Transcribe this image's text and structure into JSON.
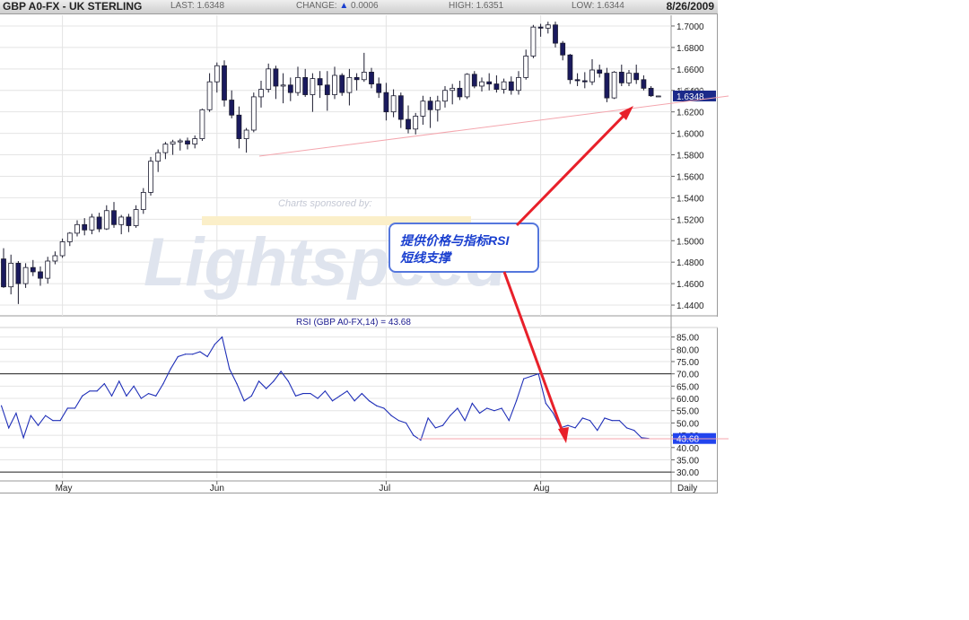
{
  "header": {
    "symbol": "GBP A0-FX - UK STERLING",
    "last_label": "LAST:",
    "last_value": "1.6348",
    "change_label": "CHANGE:",
    "change_arrow": "▲",
    "change_value": "0.0006",
    "high_label": "HIGH:",
    "high_value": "1.6351",
    "low_label": "LOW:",
    "low_value": "1.6344",
    "date": "8/26/2009"
  },
  "watermark": {
    "sponsor_text": "Charts sponsored by:",
    "logo_text": "Lightspeed"
  },
  "annotation": {
    "text_line1": "提供价格与指标RSI",
    "text_line2": "短线支撑",
    "box_border_color": "#5577dd",
    "text_color": "#1a3fcf",
    "arrow_color": "#e8202a",
    "trendline_color": "#f4a6ae"
  },
  "colors": {
    "candle_down": "#1a1a5e",
    "candle_up": "#ffffff",
    "rsi_line": "#1f2fb8",
    "grid": "#e4e4e4",
    "last_badge_bg": "#1b2a8a",
    "rsi_badge_bg": "#2244ee"
  },
  "chart_data": [
    {
      "type": "candlestick",
      "title": "GBP A0-FX - UK STERLING",
      "ylim": [
        1.43,
        1.71
      ],
      "y_ticks": [
        "1.7000",
        "1.6800",
        "1.6600",
        "1.6400",
        "1.6200",
        "1.6000",
        "1.5800",
        "1.5600",
        "1.5400",
        "1.5200",
        "1.5000",
        "1.4800",
        "1.4600",
        "1.4400"
      ],
      "last_price_label": "1.6348",
      "partial_label": "1.6400",
      "candles": [
        {
          "o": 1.483,
          "h": 1.493,
          "l": 1.456,
          "c": 1.457
        },
        {
          "o": 1.457,
          "h": 1.487,
          "l": 1.45,
          "c": 1.479
        },
        {
          "o": 1.479,
          "h": 1.481,
          "l": 1.441,
          "c": 1.46
        },
        {
          "o": 1.46,
          "h": 1.479,
          "l": 1.456,
          "c": 1.475
        },
        {
          "o": 1.475,
          "h": 1.482,
          "l": 1.467,
          "c": 1.471
        },
        {
          "o": 1.471,
          "h": 1.476,
          "l": 1.458,
          "c": 1.465
        },
        {
          "o": 1.465,
          "h": 1.485,
          "l": 1.46,
          "c": 1.481
        },
        {
          "o": 1.481,
          "h": 1.49,
          "l": 1.478,
          "c": 1.486
        },
        {
          "o": 1.486,
          "h": 1.502,
          "l": 1.484,
          "c": 1.499
        },
        {
          "o": 1.499,
          "h": 1.508,
          "l": 1.495,
          "c": 1.507
        },
        {
          "o": 1.507,
          "h": 1.519,
          "l": 1.504,
          "c": 1.515
        },
        {
          "o": 1.515,
          "h": 1.521,
          "l": 1.505,
          "c": 1.51
        },
        {
          "o": 1.51,
          "h": 1.525,
          "l": 1.506,
          "c": 1.522
        },
        {
          "o": 1.522,
          "h": 1.526,
          "l": 1.508,
          "c": 1.511
        },
        {
          "o": 1.511,
          "h": 1.533,
          "l": 1.51,
          "c": 1.528
        },
        {
          "o": 1.528,
          "h": 1.536,
          "l": 1.512,
          "c": 1.515
        },
        {
          "o": 1.515,
          "h": 1.524,
          "l": 1.506,
          "c": 1.522
        },
        {
          "o": 1.522,
          "h": 1.525,
          "l": 1.508,
          "c": 1.514
        },
        {
          "o": 1.514,
          "h": 1.533,
          "l": 1.512,
          "c": 1.529
        },
        {
          "o": 1.529,
          "h": 1.549,
          "l": 1.525,
          "c": 1.545
        },
        {
          "o": 1.545,
          "h": 1.578,
          "l": 1.542,
          "c": 1.574
        },
        {
          "o": 1.574,
          "h": 1.585,
          "l": 1.564,
          "c": 1.582
        },
        {
          "o": 1.582,
          "h": 1.592,
          "l": 1.576,
          "c": 1.59
        },
        {
          "o": 1.59,
          "h": 1.594,
          "l": 1.58,
          "c": 1.592
        },
        {
          "o": 1.592,
          "h": 1.595,
          "l": 1.584,
          "c": 1.593
        },
        {
          "o": 1.593,
          "h": 1.596,
          "l": 1.585,
          "c": 1.59
        },
        {
          "o": 1.59,
          "h": 1.598,
          "l": 1.586,
          "c": 1.595
        },
        {
          "o": 1.595,
          "h": 1.623,
          "l": 1.593,
          "c": 1.622
        },
        {
          "o": 1.622,
          "h": 1.656,
          "l": 1.62,
          "c": 1.648
        },
        {
          "o": 1.648,
          "h": 1.666,
          "l": 1.638,
          "c": 1.663
        },
        {
          "o": 1.663,
          "h": 1.668,
          "l": 1.625,
          "c": 1.631
        },
        {
          "o": 1.631,
          "h": 1.64,
          "l": 1.614,
          "c": 1.617
        },
        {
          "o": 1.617,
          "h": 1.625,
          "l": 1.586,
          "c": 1.595
        },
        {
          "o": 1.595,
          "h": 1.605,
          "l": 1.582,
          "c": 1.603
        },
        {
          "o": 1.603,
          "h": 1.638,
          "l": 1.601,
          "c": 1.634
        },
        {
          "o": 1.634,
          "h": 1.649,
          "l": 1.624,
          "c": 1.641
        },
        {
          "o": 1.641,
          "h": 1.665,
          "l": 1.638,
          "c": 1.66
        },
        {
          "o": 1.66,
          "h": 1.663,
          "l": 1.632,
          "c": 1.644
        },
        {
          "o": 1.644,
          "h": 1.656,
          "l": 1.628,
          "c": 1.645
        },
        {
          "o": 1.645,
          "h": 1.652,
          "l": 1.63,
          "c": 1.638
        },
        {
          "o": 1.638,
          "h": 1.662,
          "l": 1.635,
          "c": 1.652
        },
        {
          "o": 1.652,
          "h": 1.66,
          "l": 1.634,
          "c": 1.636
        },
        {
          "o": 1.636,
          "h": 1.656,
          "l": 1.62,
          "c": 1.651
        },
        {
          "o": 1.651,
          "h": 1.658,
          "l": 1.633,
          "c": 1.645
        },
        {
          "o": 1.645,
          "h": 1.658,
          "l": 1.621,
          "c": 1.636
        },
        {
          "o": 1.636,
          "h": 1.662,
          "l": 1.632,
          "c": 1.654
        },
        {
          "o": 1.654,
          "h": 1.656,
          "l": 1.635,
          "c": 1.638
        },
        {
          "o": 1.638,
          "h": 1.66,
          "l": 1.626,
          "c": 1.652
        },
        {
          "o": 1.652,
          "h": 1.656,
          "l": 1.64,
          "c": 1.65
        },
        {
          "o": 1.65,
          "h": 1.675,
          "l": 1.648,
          "c": 1.657
        },
        {
          "o": 1.657,
          "h": 1.661,
          "l": 1.642,
          "c": 1.646
        },
        {
          "o": 1.646,
          "h": 1.652,
          "l": 1.633,
          "c": 1.638
        },
        {
          "o": 1.638,
          "h": 1.647,
          "l": 1.612,
          "c": 1.62
        },
        {
          "o": 1.62,
          "h": 1.641,
          "l": 1.615,
          "c": 1.635
        },
        {
          "o": 1.635,
          "h": 1.638,
          "l": 1.605,
          "c": 1.613
        },
        {
          "o": 1.613,
          "h": 1.626,
          "l": 1.6,
          "c": 1.604
        },
        {
          "o": 1.604,
          "h": 1.619,
          "l": 1.599,
          "c": 1.616
        },
        {
          "o": 1.616,
          "h": 1.635,
          "l": 1.608,
          "c": 1.63
        },
        {
          "o": 1.63,
          "h": 1.634,
          "l": 1.605,
          "c": 1.622
        },
        {
          "o": 1.622,
          "h": 1.635,
          "l": 1.611,
          "c": 1.63
        },
        {
          "o": 1.63,
          "h": 1.644,
          "l": 1.624,
          "c": 1.64
        },
        {
          "o": 1.64,
          "h": 1.646,
          "l": 1.627,
          "c": 1.642
        },
        {
          "o": 1.642,
          "h": 1.649,
          "l": 1.631,
          "c": 1.634
        },
        {
          "o": 1.634,
          "h": 1.656,
          "l": 1.632,
          "c": 1.655
        },
        {
          "o": 1.655,
          "h": 1.658,
          "l": 1.642,
          "c": 1.644
        },
        {
          "o": 1.644,
          "h": 1.652,
          "l": 1.639,
          "c": 1.648
        },
        {
          "o": 1.648,
          "h": 1.656,
          "l": 1.64,
          "c": 1.646
        },
        {
          "o": 1.646,
          "h": 1.654,
          "l": 1.638,
          "c": 1.641
        },
        {
          "o": 1.641,
          "h": 1.651,
          "l": 1.637,
          "c": 1.648
        },
        {
          "o": 1.648,
          "h": 1.653,
          "l": 1.636,
          "c": 1.64
        },
        {
          "o": 1.64,
          "h": 1.658,
          "l": 1.636,
          "c": 1.652
        },
        {
          "o": 1.652,
          "h": 1.678,
          "l": 1.65,
          "c": 1.672
        },
        {
          "o": 1.672,
          "h": 1.701,
          "l": 1.67,
          "c": 1.699
        },
        {
          "o": 1.699,
          "h": 1.702,
          "l": 1.69,
          "c": 1.698
        },
        {
          "o": 1.698,
          "h": 1.704,
          "l": 1.693,
          "c": 1.701
        },
        {
          "o": 1.701,
          "h": 1.704,
          "l": 1.68,
          "c": 1.684
        },
        {
          "o": 1.684,
          "h": 1.686,
          "l": 1.668,
          "c": 1.673
        },
        {
          "o": 1.673,
          "h": 1.674,
          "l": 1.646,
          "c": 1.65
        },
        {
          "o": 1.65,
          "h": 1.656,
          "l": 1.644,
          "c": 1.649
        },
        {
          "o": 1.649,
          "h": 1.657,
          "l": 1.642,
          "c": 1.648
        },
        {
          "o": 1.648,
          "h": 1.669,
          "l": 1.645,
          "c": 1.659
        },
        {
          "o": 1.659,
          "h": 1.664,
          "l": 1.652,
          "c": 1.656
        },
        {
          "o": 1.656,
          "h": 1.661,
          "l": 1.629,
          "c": 1.633
        },
        {
          "o": 1.633,
          "h": 1.658,
          "l": 1.632,
          "c": 1.657
        },
        {
          "o": 1.657,
          "h": 1.664,
          "l": 1.644,
          "c": 1.647
        },
        {
          "o": 1.647,
          "h": 1.659,
          "l": 1.644,
          "c": 1.656
        },
        {
          "o": 1.656,
          "h": 1.664,
          "l": 1.646,
          "c": 1.65
        },
        {
          "o": 1.65,
          "h": 1.654,
          "l": 1.64,
          "c": 1.642
        },
        {
          "o": 1.642,
          "h": 1.644,
          "l": 1.634,
          "c": 1.635
        },
        {
          "o": 1.6348,
          "h": 1.6351,
          "l": 1.6344,
          "c": 1.6348
        }
      ],
      "support_line": {
        "from": {
          "index": 32,
          "y": 1.582
        },
        "to": {
          "index": 89,
          "y": 1.627
        }
      }
    },
    {
      "type": "line",
      "title": "RSI (GBP A0-FX,14) = 43.68",
      "ylim": [
        27.5,
        88.5
      ],
      "y_ticks": [
        "85.00",
        "80.00",
        "75.00",
        "70.00",
        "65.00",
        "60.00",
        "55.00",
        "50.00",
        "45.00",
        "40.00",
        "35.00",
        "30.00"
      ],
      "reference_lines": [
        70,
        30
      ],
      "series": [
        {
          "values": [
            57,
            48,
            54,
            44,
            53,
            49,
            53,
            51,
            51,
            56,
            56,
            61,
            63,
            63,
            66,
            61,
            67,
            61,
            65,
            60,
            62,
            61,
            66,
            72,
            77,
            78,
            78,
            79,
            77,
            82,
            85,
            72,
            66,
            59,
            61,
            67,
            64,
            67,
            71,
            67,
            61,
            62,
            62,
            60,
            63,
            59,
            61,
            63,
            59,
            62,
            59,
            57,
            56,
            53,
            51,
            50,
            45,
            43,
            52,
            48,
            49,
            53,
            56,
            51,
            58,
            54,
            56,
            55,
            56,
            51,
            59,
            68,
            69,
            70,
            58,
            54,
            48,
            49,
            48,
            52,
            51,
            47,
            52,
            51,
            51,
            48,
            47,
            44,
            43.68
          ]
        }
      ],
      "support_line": {
        "from": {
          "index": 56,
          "y": 43.5
        },
        "to": {
          "index": 90,
          "y": 43.5
        }
      },
      "last_value_label": "43.68"
    }
  ],
  "x_axis": {
    "month_labels": [
      {
        "label": "May",
        "index": 8
      },
      {
        "label": "Jun",
        "index": 29
      },
      {
        "label": "Jul",
        "index": 52
      },
      {
        "label": "Aug",
        "index": 73
      }
    ],
    "period_label": "Daily"
  }
}
